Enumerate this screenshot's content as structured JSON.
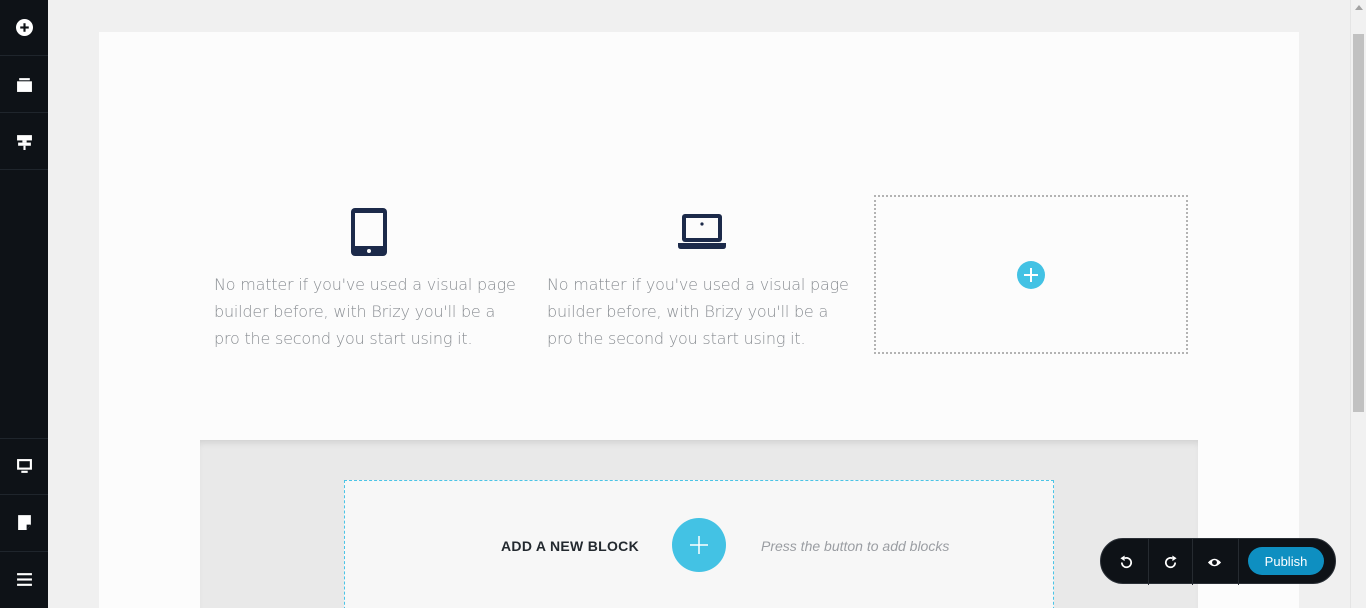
{
  "sidebar": {
    "top_items": [
      {
        "name": "add-elements",
        "icon": "plus-circle-icon"
      },
      {
        "name": "blocks",
        "icon": "blocks-icon"
      },
      {
        "name": "styling",
        "icon": "paint-roller-icon"
      }
    ],
    "bottom_items": [
      {
        "name": "device-view",
        "icon": "desktop-icon"
      },
      {
        "name": "pages",
        "icon": "page-icon"
      },
      {
        "name": "menu",
        "icon": "hamburger-icon"
      }
    ]
  },
  "features": [
    {
      "icon": "tablet-icon",
      "text": "No matter if you've used a visual page builder before, with Brizy you'll be a pro the second you start using it."
    },
    {
      "icon": "laptop-icon",
      "text": "No matter if you've used a visual page builder before, with Brizy you'll be a pro the second you start using it."
    }
  ],
  "add_block": {
    "label": "ADD A NEW BLOCK",
    "hint": "Press the button to add blocks"
  },
  "toolbar": {
    "publish_label": "Publish"
  },
  "colors": {
    "accent": "#43c2e4",
    "sidebar_bg": "#0e1217",
    "publish_bg": "#0e8fc1",
    "icon_dark": "#1c2a4a"
  }
}
